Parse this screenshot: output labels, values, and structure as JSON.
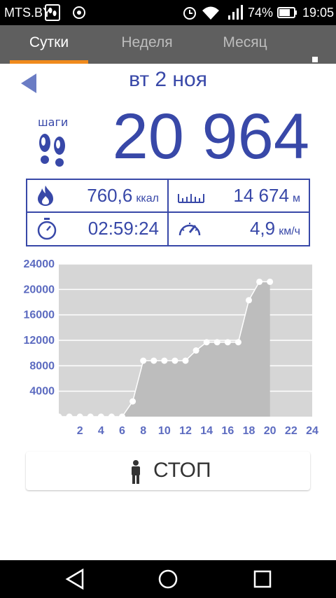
{
  "status_bar": {
    "carrier": "MTS.BY",
    "battery": "74%",
    "time": "19:05"
  },
  "tabs": [
    {
      "label": "Сутки",
      "active": true
    },
    {
      "label": "Неделя",
      "active": false
    },
    {
      "label": "Месяц",
      "active": false
    }
  ],
  "header": {
    "date": "вт 2 ноя"
  },
  "steps": {
    "label": "шаги",
    "value": "20 964"
  },
  "stats": {
    "calories": {
      "value": "760,6",
      "unit": "ккал",
      "icon": "flame-icon"
    },
    "distance": {
      "value": "14 674",
      "unit": "м",
      "icon": "ruler-icon"
    },
    "duration": {
      "value": "02:59:24",
      "icon": "stopwatch-icon"
    },
    "speed": {
      "value": "4,9",
      "unit": "км/ч",
      "icon": "speedometer-icon"
    }
  },
  "colors": {
    "accent": "#f08a1c",
    "primary": "#3848a8",
    "tab_bar": "#5f5f5f"
  },
  "chart_data": {
    "type": "area",
    "x": [
      0,
      1,
      2,
      3,
      4,
      5,
      6,
      7,
      8,
      9,
      10,
      11,
      12,
      13,
      14,
      15,
      16,
      17,
      18,
      19,
      20
    ],
    "values": [
      0,
      0,
      0,
      0,
      0,
      0,
      0,
      2400,
      8800,
      8800,
      8800,
      8800,
      8800,
      10400,
      11700,
      11700,
      11700,
      11700,
      18300,
      21200,
      21200
    ],
    "x_ticks": [
      "2",
      "4",
      "6",
      "8",
      "10",
      "12",
      "14",
      "16",
      "18",
      "20",
      "22",
      "24"
    ],
    "y_ticks": [
      "4000",
      "8000",
      "12000",
      "16000",
      "20000",
      "24000"
    ],
    "xlim": [
      0,
      24
    ],
    "ylim": [
      0,
      24000
    ],
    "grid": true
  },
  "stop_button": {
    "label": "СТОП"
  }
}
